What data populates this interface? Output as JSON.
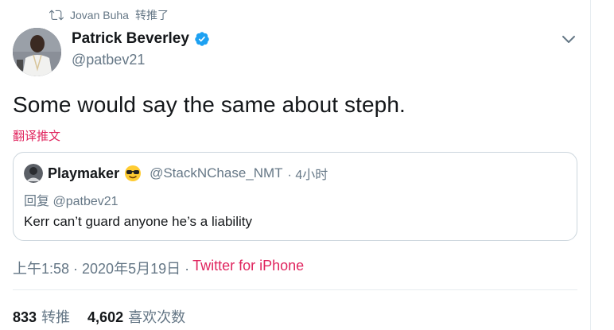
{
  "retweet": {
    "user": "Jovan Buha",
    "label": "转推了",
    "icon": "retweet-icon"
  },
  "author": {
    "display_name": "Patrick Beverley",
    "handle": "@patbev21",
    "verified": true,
    "avatar_icon": "avatar"
  },
  "menu_icon": "chevron-down-icon",
  "tweet": {
    "text": "Some would say the same about steph.",
    "translate_label": "翻译推文"
  },
  "quote": {
    "display_name": "Playmaker",
    "emoji_icon": "sunglasses-emoji",
    "handle": "@StackNChase_NMT",
    "time": "· 4小时",
    "reply_prefix": "回复",
    "reply_to": "@patbev21",
    "text": "Kerr can’t guard anyone he’s a liability"
  },
  "meta": {
    "time": "上午1:58 · 2020年5月19日 ·",
    "source": "Twitter for iPhone"
  },
  "stats": {
    "retweets_count": "833",
    "retweets_label": "转推",
    "likes_count": "4,602",
    "likes_label": "喜欢次数"
  },
  "colors": {
    "accent_blue": "#1da1f2",
    "link_pink": "#e0245e",
    "secondary_text": "#657786"
  }
}
